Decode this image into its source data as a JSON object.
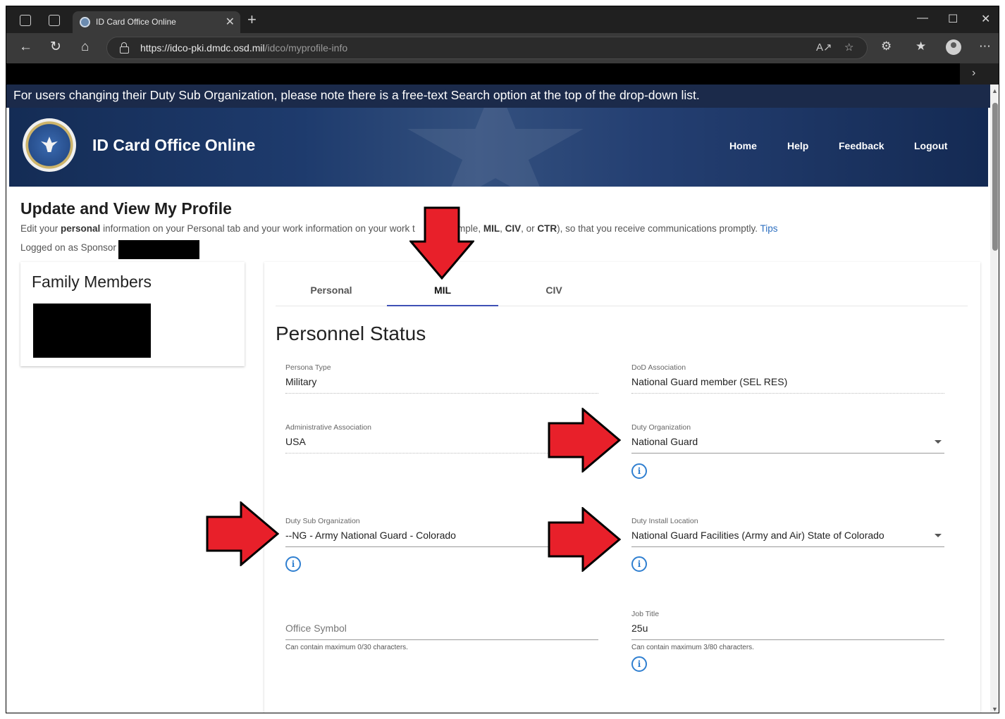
{
  "browser": {
    "tab_title": "ID Card Office Online",
    "tab_close": "✕",
    "new_tab": "+",
    "url_host": "https://idco-pki.dmdc.osd.mil",
    "url_path": "/idco/myprofile-info",
    "window_controls": {
      "minimize": "—",
      "maximize": "☐",
      "close": "✕"
    },
    "nav": {
      "back": "←",
      "reload": "↻",
      "home": "⌂"
    },
    "favorites_chevron": "›"
  },
  "notice": "For users changing their Duty Sub Organization, please note there is a free-text Search option at the top of the drop-down list.",
  "header": {
    "site_title": "ID Card Office Online",
    "nav": [
      "Home",
      "Help",
      "Feedback",
      "Logout"
    ]
  },
  "page": {
    "title": "Update and View My Profile",
    "desc_1": "Edit your ",
    "desc_bold_personal": "personal",
    "desc_2": " information on your Personal tab and your work information on your work t",
    "desc_3": "xample, ",
    "desc_mil": "MIL",
    "desc_sep1": ", ",
    "desc_civ": "CIV",
    "desc_sep2": ", or ",
    "desc_ctr": "CTR",
    "desc_4": "), so that you receive communications promptly. ",
    "tips": "Tips",
    "logged_on": "Logged on as Sponsor"
  },
  "family": {
    "title": "Family Members"
  },
  "tabs": [
    "Personal",
    "MIL",
    "CIV"
  ],
  "active_tab": "MIL",
  "section_title": "Personnel Status",
  "fields": {
    "persona_type": {
      "label": "Persona Type",
      "value": "Military"
    },
    "dod_association": {
      "label": "DoD Association",
      "value": "National Guard member (SEL RES)"
    },
    "admin_association": {
      "label": "Administrative Association",
      "value": "USA"
    },
    "duty_org": {
      "label": "Duty Organization",
      "value": "National Guard"
    },
    "duty_sub_org": {
      "label": "Duty Sub Organization",
      "value": "--NG - Army National Guard - Colorado"
    },
    "duty_install": {
      "label": "Duty Install Location",
      "value": "National Guard Facilities (Army and Air) State of Colorado"
    },
    "office_symbol": {
      "placeholder": "Office Symbol",
      "hint": "Can contain maximum 0/30 characters."
    },
    "job_title": {
      "label": "Job Title",
      "value": "25u",
      "hint": "Can contain maximum 3/80 characters."
    }
  },
  "info_icon": "i",
  "colors": {
    "accent": "#3f51b5",
    "link": "#2d6fc0",
    "banner": "#1e3b6d",
    "arrow": "#e8202a"
  }
}
